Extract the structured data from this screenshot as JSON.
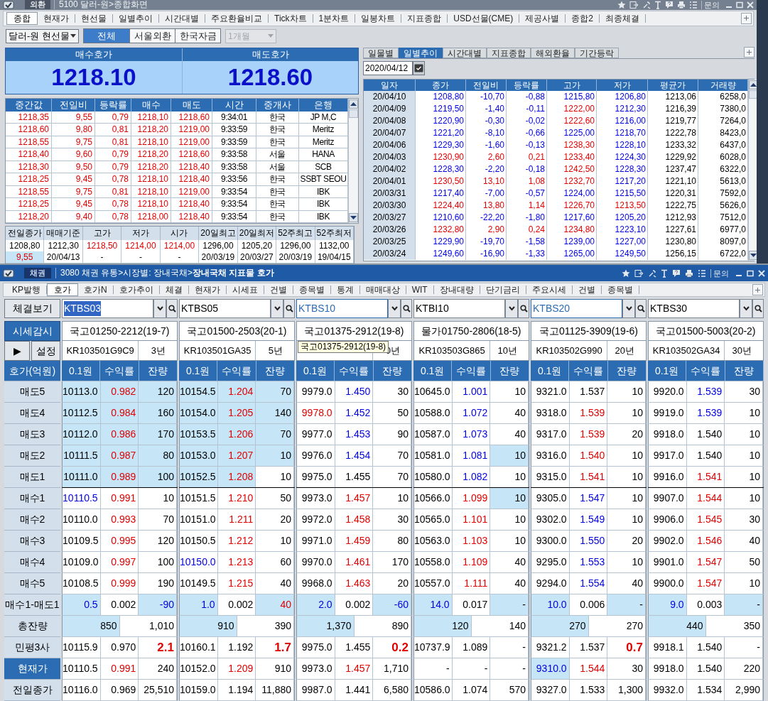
{
  "top_window": {
    "badge": "외환",
    "title": "5100 달러-원>종합화면",
    "menu_label": "문의",
    "tabs": [
      {
        "label": "종합",
        "selected": true
      },
      {
        "label": "현재가",
        "selected": false
      },
      {
        "label": "현선물",
        "selected": false
      },
      {
        "label": "일별추이",
        "selected": false
      },
      {
        "label": "시간대별",
        "selected": false
      },
      {
        "label": "주요환율비교",
        "selected": false
      },
      {
        "label": "Tick차트",
        "selected": false
      },
      {
        "label": "1분차트",
        "selected": false
      },
      {
        "label": "일봉차트",
        "selected": false
      },
      {
        "label": "지표종합",
        "selected": false
      },
      {
        "label": "USD선물(CME)",
        "selected": false
      },
      {
        "label": "제공사별",
        "selected": false
      },
      {
        "label": "종합2",
        "selected": false
      },
      {
        "label": "최종체결",
        "selected": false
      }
    ],
    "market_dropdown": {
      "value": "달러-원 현선물"
    },
    "source_buttons": [
      {
        "label": "전체",
        "selected": true
      },
      {
        "label": "서울외환",
        "selected": false
      },
      {
        "label": "한국자금",
        "selected": false
      }
    ],
    "period_dropdown": {
      "value": "1개월",
      "disabled": true
    },
    "quotes": [
      {
        "label": "매수호가",
        "value": "1218.10"
      },
      {
        "label": "매도호가",
        "value": "1218.60"
      }
    ],
    "ticks": {
      "columns": [
        {
          "label": "중간값",
          "color": "#e00000"
        },
        {
          "label": "전일비",
          "color": "#e00000"
        },
        {
          "label": "등락률",
          "color": "#e00000"
        },
        {
          "label": "매수",
          "color": "#e00000"
        },
        {
          "label": "매도",
          "color": "#e00000"
        },
        {
          "label": "시간"
        },
        {
          "label": "중개사"
        },
        {
          "label": "은행"
        }
      ],
      "rows": [
        [
          "1218,35",
          "9,55",
          "0,79",
          "1218,10",
          "1218,60",
          "9:34:01",
          "한국",
          "JP M,C"
        ],
        [
          "1218,60",
          "9,80",
          "0,81",
          "1218,20",
          "1219,00",
          "9:33:59",
          "한국",
          "Meritz"
        ],
        [
          "1218,55",
          "9,75",
          "0,81",
          "1218,10",
          "1219,00",
          "9:33:59",
          "한국",
          "Meritz"
        ],
        [
          "1218,40",
          "9,60",
          "0,79",
          "1218,20",
          "1218,60",
          "9:33:58",
          "서울",
          "HANA"
        ],
        [
          "1218,30",
          "9,50",
          "0,79",
          "1218,20",
          "1218,40",
          "9:33:58",
          "서울",
          "SCB"
        ],
        [
          "1218,25",
          "9,45",
          "0,78",
          "1218,10",
          "1218,40",
          "9:33:56",
          "한국",
          "SSBT SEOU"
        ],
        [
          "1218,55",
          "9,75",
          "0,81",
          "1218,10",
          "1219,00",
          "9:33:54",
          "한국",
          "IBK"
        ],
        [
          "1218,25",
          "9,45",
          "0,78",
          "1218,10",
          "1218,40",
          "9:33:54",
          "한국",
          "IBK"
        ],
        [
          "1218,20",
          "9,40",
          "0,78",
          "1218,00",
          "1218,40",
          "9:33:54",
          "한국",
          "IBK"
        ]
      ]
    },
    "summary": {
      "columns": [
        "전일종가",
        "매매기준",
        "고가",
        "저가",
        "시가",
        "20일최고",
        "20일최저",
        "52주최고",
        "52주최저"
      ],
      "rows": [
        [
          "1208,80",
          "1212,30",
          {
            "text": "1218,50",
            "color": "#e00000"
          },
          {
            "text": "1214,00",
            "color": "#e00000"
          },
          {
            "text": "1214,00",
            "color": "#e00000"
          },
          "1296,00",
          "1205,20",
          "1296,00",
          "1132,00"
        ],
        [
          {
            "text": "9,55",
            "color": "#e00000",
            "highlighted": true
          },
          "20/04/13",
          "-",
          "-",
          "-",
          "20/03/19",
          "20/03/27",
          "20/03/19",
          "19/04/15"
        ]
      ]
    },
    "sub_tabs": [
      {
        "label": "일물별",
        "selected": false
      },
      {
        "label": "일별추이",
        "selected": true
      },
      {
        "label": "시간대별",
        "selected": false
      },
      {
        "label": "지표종합",
        "selected": false
      },
      {
        "label": "해외환율",
        "selected": false
      },
      {
        "label": "기간등락",
        "selected": false
      }
    ],
    "date_field": {
      "value": "2020/04/12"
    },
    "daily": {
      "columns": [
        "일자",
        "종가",
        "전일비",
        "등락률",
        "고가",
        "저가",
        "평균가",
        "거래량"
      ],
      "rows": [
        [
          "20/04/10",
          {
            "text": "1208,80",
            "color": "#0000e0"
          },
          {
            "text": "-10,70",
            "color": "#0000e0"
          },
          {
            "text": "-0,88",
            "color": "#0000e0"
          },
          {
            "text": "1215,80",
            "color": "#0000e0"
          },
          {
            "text": "1206,80",
            "color": "#0000e0"
          },
          "1213,06",
          "6258,0"
        ],
        [
          "20/04/09",
          {
            "text": "1219,50",
            "color": "#0000e0"
          },
          {
            "text": "-1,40",
            "color": "#0000e0"
          },
          {
            "text": "-0,11",
            "color": "#0000e0"
          },
          {
            "text": "1222,00",
            "color": "#e00000"
          },
          {
            "text": "1212,30",
            "color": "#0000e0"
          },
          "1216,39",
          "7380,0"
        ],
        [
          "20/04/08",
          {
            "text": "1220,90",
            "color": "#0000e0"
          },
          {
            "text": "-0,30",
            "color": "#0000e0"
          },
          {
            "text": "-0,02",
            "color": "#0000e0"
          },
          {
            "text": "1222,60",
            "color": "#e00000"
          },
          {
            "text": "1216,00",
            "color": "#0000e0"
          },
          "1219,77",
          "7264,0"
        ],
        [
          "20/04/07",
          {
            "text": "1221,20",
            "color": "#0000e0"
          },
          {
            "text": "-8,10",
            "color": "#0000e0"
          },
          {
            "text": "-0,66",
            "color": "#0000e0"
          },
          {
            "text": "1225,00",
            "color": "#0000e0"
          },
          {
            "text": "1218,70",
            "color": "#0000e0"
          },
          "1222,78",
          "8423,0"
        ],
        [
          "20/04/06",
          {
            "text": "1229,30",
            "color": "#0000e0"
          },
          {
            "text": "-1,60",
            "color": "#0000e0"
          },
          {
            "text": "-0,13",
            "color": "#0000e0"
          },
          {
            "text": "1238,30",
            "color": "#e00000"
          },
          {
            "text": "1228,10",
            "color": "#0000e0"
          },
          "1233,32",
          "6437,0"
        ],
        [
          "20/04/03",
          {
            "text": "1230,90",
            "color": "#e00000"
          },
          {
            "text": "2,60",
            "color": "#e00000"
          },
          {
            "text": "0,21",
            "color": "#e00000"
          },
          {
            "text": "1233,40",
            "color": "#e00000"
          },
          {
            "text": "1224,30",
            "color": "#0000e0"
          },
          "1229,92",
          "6028,0"
        ],
        [
          "20/04/02",
          {
            "text": "1228,30",
            "color": "#0000e0"
          },
          {
            "text": "-2,20",
            "color": "#0000e0"
          },
          {
            "text": "-0,18",
            "color": "#0000e0"
          },
          {
            "text": "1242,50",
            "color": "#e00000"
          },
          {
            "text": "1228,30",
            "color": "#0000e0"
          },
          "1237,47",
          "6322,0"
        ],
        [
          "20/04/01",
          {
            "text": "1230,50",
            "color": "#e00000"
          },
          {
            "text": "13,10",
            "color": "#e00000"
          },
          {
            "text": "1,08",
            "color": "#e00000"
          },
          {
            "text": "1232,70",
            "color": "#e00000"
          },
          {
            "text": "1217,20",
            "color": "#0000e0"
          },
          "1221,10",
          "5613,0"
        ],
        [
          "20/03/31",
          {
            "text": "1217,40",
            "color": "#0000e0"
          },
          {
            "text": "-7,00",
            "color": "#0000e0"
          },
          {
            "text": "-0,57",
            "color": "#0000e0"
          },
          {
            "text": "1224,00",
            "color": "#0000e0"
          },
          {
            "text": "1215,50",
            "color": "#0000e0"
          },
          "1220,31",
          "7592,0"
        ],
        [
          "20/03/30",
          {
            "text": "1224,40",
            "color": "#e00000"
          },
          {
            "text": "13,80",
            "color": "#e00000"
          },
          {
            "text": "1,14",
            "color": "#e00000"
          },
          {
            "text": "1226,70",
            "color": "#e00000"
          },
          {
            "text": "1213,50",
            "color": "#e00000"
          },
          "1222,75",
          "5626,0"
        ],
        [
          "20/03/27",
          {
            "text": "1210,60",
            "color": "#0000e0"
          },
          {
            "text": "-22,20",
            "color": "#0000e0"
          },
          {
            "text": "-1,80",
            "color": "#0000e0"
          },
          {
            "text": "1217,60",
            "color": "#0000e0"
          },
          {
            "text": "1205,20",
            "color": "#0000e0"
          },
          "1212,93",
          "7512,0"
        ],
        [
          "20/03/26",
          {
            "text": "1232,80",
            "color": "#e00000"
          },
          {
            "text": "2,90",
            "color": "#e00000"
          },
          {
            "text": "0,24",
            "color": "#e00000"
          },
          {
            "text": "1234,80",
            "color": "#e00000"
          },
          {
            "text": "1223,10",
            "color": "#0000e0"
          },
          "1227,61",
          "6977,0"
        ],
        [
          "20/03/25",
          {
            "text": "1229,90",
            "color": "#0000e0"
          },
          {
            "text": "-19,70",
            "color": "#0000e0"
          },
          {
            "text": "-1,58",
            "color": "#0000e0"
          },
          {
            "text": "1239,00",
            "color": "#0000e0"
          },
          {
            "text": "1227,00",
            "color": "#0000e0"
          },
          "1230,80",
          "8097,0"
        ],
        [
          "20/03/24",
          {
            "text": "1249,60",
            "color": "#0000e0"
          },
          {
            "text": "-16,90",
            "color": "#0000e0"
          },
          {
            "text": "-1,33",
            "color": "#0000e0"
          },
          {
            "text": "1265,00",
            "color": "#0000e0"
          },
          {
            "text": "1249,50",
            "color": "#0000e0"
          },
          "1256,15",
          "6722,0"
        ]
      ]
    }
  },
  "bottom_window": {
    "badge": "채권",
    "title": "3080 채권 유통>시장별: 장내국채>**장내국채 지표물 호가**",
    "menu_label": "문의",
    "tabs": [
      {
        "label": "KP발행",
        "selected": false
      },
      {
        "label": "호가",
        "selected": true
      },
      {
        "label": "호가N",
        "selected": false
      },
      {
        "label": "호가추이",
        "selected": false
      },
      {
        "label": "체결",
        "selected": false
      },
      {
        "label": "현재가",
        "selected": false
      },
      {
        "label": "시세표",
        "selected": false
      },
      {
        "label": "건별",
        "selected": false
      },
      {
        "label": "종목별",
        "selected": false
      },
      {
        "label": "통계",
        "selected": false
      },
      {
        "label": "매매대상",
        "selected": false
      },
      {
        "label": "WIT",
        "selected": false
      },
      {
        "label": "장내대량",
        "selected": false
      },
      {
        "label": "단기금리",
        "selected": false
      },
      {
        "label": "주요시세",
        "selected": false
      },
      {
        "label": "건별",
        "selected": false
      },
      {
        "label": "종목별",
        "selected": false
      }
    ],
    "view_button": "체결보기",
    "watch_button": "시세감시",
    "play_button": "▶",
    "settings_button": "설정",
    "grid_header": "호가(억원)",
    "row_labels": [
      "매도5",
      "매도4",
      "매도3",
      "매도2",
      "매도1",
      "매수1",
      "매수2",
      "매수3",
      "매수4",
      "매수5",
      "매수1-매도1",
      "총잔량",
      "민평3사",
      {
        "text": "현재가",
        "highlighted": true
      },
      "전일종가"
    ],
    "bonds": [
      {
        "code": "KTBS03",
        "selected": true,
        "active": false,
        "name": "국고01250-2212(19-7)",
        "isin": "KR103501G9C9",
        "tenor": "3년",
        "totals": [
          {
            "text": "850",
            "highlighted": true
          },
          "1,010"
        ],
        "columns": [
          "0.1원",
          "수익률",
          "잔량"
        ],
        "rows": [
          [
            {
              "text": "10113.0",
              "highlighted": true
            },
            {
              "text": "0.982",
              "color": "#e00000",
              "highlighted": true
            },
            {
              "text": "120",
              "highlighted": true
            }
          ],
          [
            {
              "text": "10112.5",
              "highlighted": true
            },
            {
              "text": "0.984",
              "color": "#e00000",
              "highlighted": true
            },
            {
              "text": "160",
              "highlighted": true
            }
          ],
          [
            {
              "text": "10112.0",
              "highlighted": true
            },
            {
              "text": "0.986",
              "color": "#e00000",
              "highlighted": true
            },
            {
              "text": "170",
              "highlighted": true
            }
          ],
          [
            {
              "text": "10111.5",
              "highlighted": true
            },
            {
              "text": "0.987",
              "color": "#e00000",
              "highlighted": true
            },
            {
              "text": "80",
              "highlighted": true
            }
          ],
          [
            {
              "text": "10111.0",
              "highlighted": true
            },
            {
              "text": "0.989",
              "color": "#e00000",
              "highlighted": true
            },
            {
              "text": "100",
              "highlighted": true
            }
          ],
          [
            {
              "text": "10110.5",
              "color": "#0000e0"
            },
            {
              "text": "0.991",
              "color": "#e00000"
            },
            "10"
          ],
          [
            "10110.0",
            {
              "text": "0.993",
              "color": "#e00000"
            },
            "70"
          ],
          [
            "10109.5",
            {
              "text": "0.995",
              "color": "#e00000"
            },
            "120"
          ],
          [
            "10109.0",
            {
              "text": "0.997",
              "color": "#e00000"
            },
            "100"
          ],
          [
            "10108.5",
            {
              "text": "0.999",
              "color": "#e00000"
            },
            "190"
          ],
          [
            {
              "text": "0.5",
              "color": "#0000e0",
              "highlighted": true
            },
            "0.002",
            {
              "text": "-90",
              "color": "#0000e0",
              "highlighted": true
            }
          ],
          [
            "10115.9",
            "0.970",
            {
              "text": "2.1",
              "color": "#e00000",
              "bold": true
            }
          ],
          [
            "10110.5",
            {
              "text": "0.991",
              "color": "#e00000"
            },
            "240"
          ],
          [
            "10116.0",
            "0.969",
            "25,510"
          ]
        ]
      },
      {
        "code": "KTBS05",
        "selected": false,
        "active": false,
        "name": "국고01500-2503(20-1)",
        "isin": "KR103501GA35",
        "tenor": "5년",
        "totals": [
          {
            "text": "910",
            "highlighted": true
          },
          "390"
        ],
        "columns": [
          "0.1원",
          "수익률",
          "잔량"
        ],
        "rows": [
          [
            {
              "text": "10154.5",
              "highlighted": true
            },
            {
              "text": "1.204",
              "color": "#e00000",
              "highlighted": true
            },
            {
              "text": "70",
              "highlighted": true
            }
          ],
          [
            {
              "text": "10154.0",
              "highlighted": true
            },
            {
              "text": "1.205",
              "color": "#e00000",
              "highlighted": true
            },
            {
              "text": "140",
              "highlighted": true
            }
          ],
          [
            {
              "text": "10153.5",
              "highlighted": true
            },
            {
              "text": "1.206",
              "color": "#e00000",
              "highlighted": true
            },
            {
              "text": "70",
              "highlighted": true
            }
          ],
          [
            {
              "text": "10153.0",
              "highlighted": true
            },
            {
              "text": "1.207",
              "color": "#e00000",
              "highlighted": true
            },
            {
              "text": "10",
              "highlighted": true
            }
          ],
          [
            {
              "text": "10152.5",
              "highlighted": true
            },
            {
              "text": "1.208",
              "color": "#e00000",
              "highlighted": true
            },
            "10"
          ],
          [
            "10151.5",
            {
              "text": "1.210",
              "color": "#e00000"
            },
            "50"
          ],
          [
            "10151.0",
            {
              "text": "1.211",
              "color": "#e00000"
            },
            "20"
          ],
          [
            "10150.5",
            {
              "text": "1.212",
              "color": "#e00000"
            },
            "10"
          ],
          [
            {
              "text": "10150.0",
              "color": "#0000e0"
            },
            {
              "text": "1.213",
              "color": "#e00000"
            },
            "60"
          ],
          [
            "10149.5",
            {
              "text": "1.215",
              "color": "#e00000"
            },
            "40"
          ],
          [
            {
              "text": "1.0",
              "color": "#0000e0",
              "highlighted": true
            },
            "0.002",
            {
              "text": "40",
              "color": "#e00000",
              "highlighted": true
            }
          ],
          [
            "10160.1",
            "1.192",
            {
              "text": "1.7",
              "color": "#e00000",
              "bold": true
            }
          ],
          [
            "10152.0",
            {
              "text": "1.209",
              "color": "#e00000"
            },
            "910"
          ],
          [
            "10159.0",
            "1.194",
            "11,880"
          ]
        ]
      },
      {
        "code": "KTBS10",
        "selected": false,
        "active": true,
        "name": "국고01375-2912(19-8)",
        "tenor": "0년",
        "totals": [
          {
            "text": "1,370",
            "highlighted": true
          },
          "890"
        ],
        "tooltip": "국고01375-2912(19-8)",
        "columns": [
          "0.1원",
          "수익률",
          "잔량"
        ],
        "rows": [
          [
            "9979.0",
            {
              "text": "1.450",
              "color": "#0000e0"
            },
            "30"
          ],
          [
            {
              "text": "9978.0",
              "color": "#e00000"
            },
            {
              "text": "1.452",
              "color": "#0000e0"
            },
            "50"
          ],
          [
            "9977.0",
            {
              "text": "1.453",
              "color": "#0000e0"
            },
            "90"
          ],
          [
            "9976.0",
            {
              "text": "1.454",
              "color": "#0000e0"
            },
            "70"
          ],
          [
            "9975.0",
            "1.455",
            "70"
          ],
          [
            "9973.0",
            {
              "text": "1.457",
              "color": "#e00000"
            },
            "10"
          ],
          [
            "9972.0",
            {
              "text": "1.458",
              "color": "#e00000"
            },
            "30"
          ],
          [
            "9971.0",
            {
              "text": "1.459",
              "color": "#e00000"
            },
            "80"
          ],
          [
            "9970.0",
            {
              "text": "1.461",
              "color": "#e00000"
            },
            "170"
          ],
          [
            "9968.0",
            {
              "text": "1.463",
              "color": "#e00000"
            },
            "20"
          ],
          [
            {
              "text": "2.0",
              "color": "#0000e0",
              "highlighted": true
            },
            "0.002",
            {
              "text": "-60",
              "color": "#0000e0",
              "highlighted": true
            }
          ],
          [
            "9975.0",
            "1.455",
            {
              "text": "0.2",
              "color": "#e00000",
              "bold": true
            }
          ],
          [
            "9973.0",
            {
              "text": "1.457",
              "color": "#e00000"
            },
            "1,710"
          ],
          [
            "9987.0",
            "1.441",
            "6,580"
          ]
        ]
      },
      {
        "code": "KTBI10",
        "selected": false,
        "active": false,
        "name": "물가01750-2806(18-5)",
        "isin": "KR103503G865",
        "tenor": "10년",
        "totals": [
          {
            "text": "120",
            "highlighted": true
          },
          "140"
        ],
        "columns": [
          "0.1원",
          "수익률",
          "잔량"
        ],
        "rows": [
          [
            "10645.0",
            {
              "text": "1.001",
              "color": "#0000e0"
            },
            "10"
          ],
          [
            "10588.0",
            {
              "text": "1.072",
              "color": "#0000e0"
            },
            "40"
          ],
          [
            "10587.0",
            {
              "text": "1.073",
              "color": "#0000e0"
            },
            "40"
          ],
          [
            "10581.0",
            {
              "text": "1.081",
              "color": "#0000e0"
            },
            {
              "text": "10",
              "highlighted": true
            }
          ],
          [
            "10580.0",
            {
              "text": "1.082",
              "color": "#0000e0"
            },
            "10"
          ],
          [
            "10566.0",
            {
              "text": "1.099",
              "color": "#e00000"
            },
            {
              "text": "10",
              "highlighted": true
            }
          ],
          [
            "10565.0",
            {
              "text": "1.101",
              "color": "#e00000"
            },
            "10"
          ],
          [
            "10563.0",
            {
              "text": "1.103",
              "color": "#e00000"
            },
            "10"
          ],
          [
            "10558.0",
            {
              "text": "1.109",
              "color": "#e00000"
            },
            "40"
          ],
          [
            "10557.0",
            {
              "text": "1.111",
              "color": "#e00000"
            },
            "40"
          ],
          [
            {
              "text": "14.0",
              "color": "#0000e0",
              "highlighted": true
            },
            "0.017",
            {
              "text": "-",
              "highlighted": true
            }
          ],
          [
            "10737.9",
            "1.089",
            "-"
          ],
          [
            "-",
            "-",
            "-"
          ],
          [
            "10586.0",
            "1.074",
            "570"
          ]
        ]
      },
      {
        "code": "KTBS20",
        "selected": false,
        "active": true,
        "name": "국고01125-3909(19-6)",
        "isin": "KR103502G990",
        "tenor": "20년",
        "totals": [
          {
            "text": "270",
            "highlighted": true
          },
          "270"
        ],
        "columns": [
          "0.1원",
          "수익률",
          "잔량"
        ],
        "rows": [
          [
            "9321.0",
            "1.537",
            "10"
          ],
          [
            "9318.0",
            {
              "text": "1.539",
              "color": "#e00000"
            },
            "10"
          ],
          [
            "9317.0",
            {
              "text": "1.539",
              "color": "#e00000"
            },
            "20"
          ],
          [
            "9316.0",
            {
              "text": "1.540",
              "color": "#e00000"
            },
            "10"
          ],
          [
            "9315.0",
            {
              "text": "1.541",
              "color": "#e00000"
            },
            "10"
          ],
          [
            "9305.0",
            {
              "text": "1.547",
              "color": "#0000e0"
            },
            "10"
          ],
          [
            "9302.0",
            {
              "text": "1.549",
              "color": "#0000e0"
            },
            "10"
          ],
          [
            "9300.0",
            {
              "text": "1.550",
              "color": "#0000e0"
            },
            "20"
          ],
          [
            "9295.0",
            {
              "text": "1.553",
              "color": "#0000e0"
            },
            "10"
          ],
          [
            "9294.0",
            {
              "text": "1.554",
              "color": "#0000e0"
            },
            "40"
          ],
          [
            {
              "text": "10.0",
              "color": "#0000e0",
              "highlighted": true
            },
            "0.006",
            {
              "text": "-",
              "highlighted": true
            }
          ],
          [
            "9321.2",
            "1.537",
            {
              "text": "0.7",
              "color": "#e00000",
              "bold": true
            }
          ],
          [
            {
              "text": "9310.0",
              "color": "#0000e0",
              "highlighted": true
            },
            {
              "text": "1.544",
              "color": "#e00000"
            },
            "30"
          ],
          [
            "9327.0",
            "1.533",
            "1,300"
          ]
        ]
      },
      {
        "code": "KTBS30",
        "selected": false,
        "active": false,
        "name": "국고01500-5003(20-2)",
        "isin": "KR103502GA34",
        "tenor": "30년",
        "totals": [
          {
            "text": "440",
            "highlighted": true
          },
          "350"
        ],
        "columns": [
          "0.1원",
          "수익률",
          "잔량"
        ],
        "rows": [
          [
            "9920.0",
            {
              "text": "1.539",
              "color": "#0000e0"
            },
            "30"
          ],
          [
            "9919.0",
            {
              "text": "1.539",
              "color": "#0000e0"
            },
            "10"
          ],
          [
            "9918.0",
            "1.540",
            "10"
          ],
          [
            "9917.0",
            "1.540",
            "10"
          ],
          [
            "9916.0",
            {
              "text": "1.541",
              "color": "#e00000"
            },
            "10"
          ],
          [
            "9907.0",
            {
              "text": "1.544",
              "color": "#e00000"
            },
            "10"
          ],
          [
            "9906.0",
            {
              "text": "1.545",
              "color": "#e00000"
            },
            "30"
          ],
          [
            "9902.0",
            {
              "text": "1.546",
              "color": "#e00000"
            },
            "40"
          ],
          [
            "9901.0",
            {
              "text": "1.547",
              "color": "#e00000"
            },
            "50"
          ],
          [
            "9900.0",
            {
              "text": "1.547",
              "color": "#e00000"
            },
            "10"
          ],
          [
            {
              "text": "9.0",
              "color": "#0000e0",
              "highlighted": true
            },
            "0.003",
            {
              "text": "-",
              "highlighted": true
            }
          ],
          [
            "9918.1",
            "1.540",
            "-"
          ],
          [
            "9918.0",
            "1.540",
            "220"
          ],
          [
            "9932.0",
            "1.534",
            "2,990"
          ]
        ]
      }
    ]
  }
}
